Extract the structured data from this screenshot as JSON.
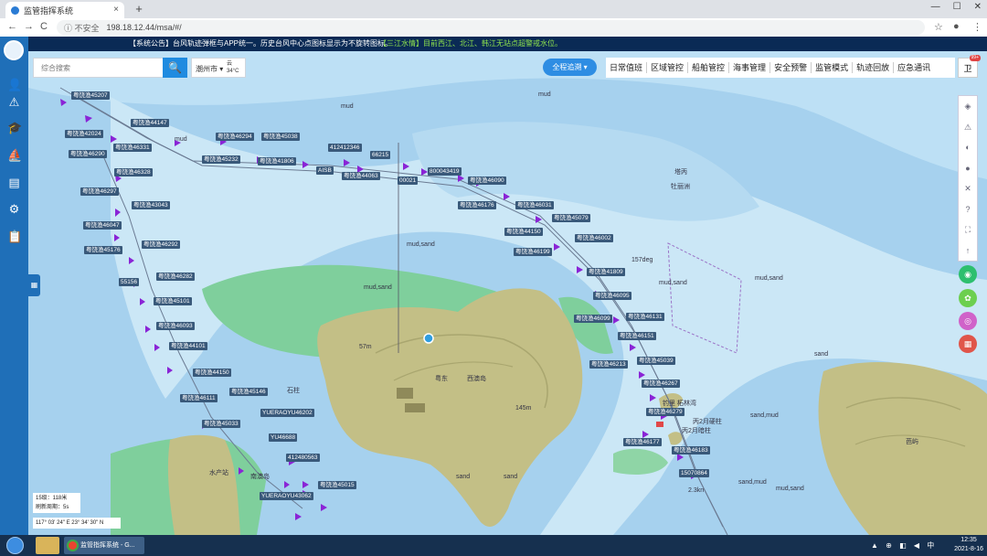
{
  "browser": {
    "tab_title": "监管指挥系统",
    "tab_close": "×",
    "new_tab": "+",
    "window_controls": [
      "—",
      "☐",
      "✕"
    ],
    "back": "←",
    "forward": "→",
    "reload": "C",
    "security_label": "ⓘ 不安全",
    "url": "198.18.12.44/msa/#/",
    "bookmark_star": "☆",
    "profile": "●",
    "menu": "⋮"
  },
  "sidebar": {
    "icons": [
      "user-icon",
      "alert-icon",
      "education-icon",
      "ship-icon",
      "document-icon",
      "settings-icon",
      "clipboard-icon"
    ],
    "glyphs": [
      "👤",
      "⚠",
      "🎓",
      "⛵",
      "▤",
      "⚙",
      "📋"
    ]
  },
  "notice": {
    "system": "【系统公告】台风轨迹弹框与APP统一。历史台风中心点图标显示为不旋转图标。",
    "water": "【三江水情】目前西江、北江、韩江无站点超警戒水位。"
  },
  "search": {
    "placeholder": "综合搜索",
    "button_icon": "🔍",
    "city": "潮州市 ▾",
    "weather_icon": "云",
    "temperature": "34°C"
  },
  "tracking_button": "全程追溯 ▾",
  "top_menu": [
    "日常值班",
    "区域管控",
    "船舶管控",
    "海事管理",
    "安全预警",
    "监管模式",
    "轨迹回放",
    "应急通讯"
  ],
  "user_button": {
    "label": "卫",
    "badge": "99+"
  },
  "right_tools": [
    "◈",
    "⚠",
    "◐",
    "●",
    "✕",
    "?",
    "⛶",
    "↑"
  ],
  "right_circles": [
    {
      "label": "◉",
      "color": "#2dbf6e"
    },
    {
      "label": "✿",
      "color": "#6ccf4f"
    },
    {
      "label": "◎",
      "color": "#d062c9"
    },
    {
      "label": "▦",
      "color": "#e0554a"
    }
  ],
  "expander_label": "▦",
  "scale": {
    "line1": "15级：118米",
    "line2": "刷新周期：5s"
  },
  "coordinates": "117° 03' 24\" E    23° 34' 30\" N",
  "ship_labels": [
    "粤饶渔45207",
    "粤饶渔44147",
    "粤饶渔42024",
    "粤饶渔46331",
    "粤饶渔46290",
    "粤饶渔46328",
    "粤饶渔46297",
    "粤饶渔46294",
    "粤饶渔45038",
    "粤饶渔45232",
    "粤饶渔41806",
    "412412346",
    "66215",
    "AISB",
    "粤饶渔44063",
    "00021",
    "800043419",
    "粤饶渔46090",
    "粤饶渔43043",
    "粤饶渔46047",
    "粤饶渔46176",
    "粤饶渔46031",
    "粤饶渔45079",
    "粤饶渔45176",
    "粤饶渔46292",
    "粤饶渔44150",
    "粤饶渔46002",
    "粤饶渔46199",
    "粤饶渔41809",
    "粤饶渔46282",
    "55156",
    "粤饶渔46095",
    "粤饶渔45101",
    "粤饶渔46099",
    "粤饶渔46131",
    "粤饶渔46093",
    "粤饶渔46151",
    "粤饶渔44101",
    "粤饶渔45039",
    "粤饶渔46213",
    "粤饶渔44150",
    "粤饶渔46267",
    "粤饶渔46111",
    "粤饶渔45146",
    "粤饶渔46279",
    "YUERAOYU46202",
    "粤饶渔45033",
    "YU46688",
    "412480563",
    "粤饶渔46177",
    "粤饶渔46183",
    "粤饶渔45015",
    "15070864",
    "YUERAOYU43062"
  ],
  "map_texts": [
    "mud",
    "mud",
    "mud",
    "mud,sand",
    "mud,sand",
    "mud,sand",
    "sand",
    "sand,mud",
    "sand,mud",
    "mud,sand",
    "157deg",
    "塔丙",
    "牡丽洲",
    "粤东",
    "西澳岛",
    "石柱",
    "水产站",
    "南澳岛",
    "芭屿",
    "钓里 柘林湾",
    "丙2月硬柱",
    "丙2月暗柱",
    "145m",
    "57m",
    "2.3kn",
    "mud,sand",
    "sand",
    "sand"
  ],
  "taskbar": {
    "app_label": "监管指挥系统 - G...",
    "time": "12:35",
    "date": "2021-8-16",
    "tray": "▲ ⊕ ◧ ◀ 中"
  }
}
